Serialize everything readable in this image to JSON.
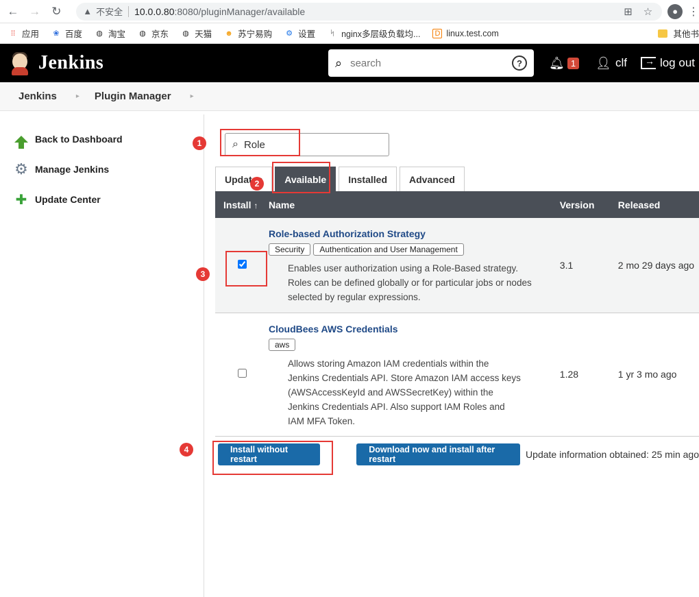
{
  "browser": {
    "warning": "不安全",
    "url_host": "10.0.0.80",
    "url_path": ":8080/pluginManager/available",
    "bookmarks": [
      "应用",
      "百度",
      "淘宝",
      "京东",
      "天猫",
      "苏宁易购",
      "设置",
      "nginx多层级负载均...",
      "linux.test.com"
    ],
    "other_bookmarks": "其他书"
  },
  "header": {
    "logo_text": "Jenkins",
    "search_placeholder": "search",
    "notifications_count": "1",
    "username": "clf",
    "logout": "log out"
  },
  "breadcrumb": {
    "items": [
      "Jenkins",
      "Plugin Manager"
    ]
  },
  "sidebar": {
    "items": [
      {
        "label": "Back to Dashboard"
      },
      {
        "label": "Manage Jenkins"
      },
      {
        "label": "Update Center"
      }
    ]
  },
  "filter": {
    "value": "Role"
  },
  "tabs": [
    {
      "label": "Updates"
    },
    {
      "label": "Available"
    },
    {
      "label": "Installed"
    },
    {
      "label": "Advanced"
    }
  ],
  "table": {
    "headers": {
      "install": "Install",
      "sort_marker": "↑",
      "name": "Name",
      "version": "Version",
      "released": "Released"
    },
    "rows": [
      {
        "name": "Role-based Authorization Strategy",
        "labels": [
          "Security",
          "Authentication and User Management"
        ],
        "description": "Enables user authorization using a Role-Based strategy. Roles can be defined globally or for particular jobs or nodes selected by regular expressions.",
        "version": "3.1",
        "released": "2 mo 29 days ago",
        "checked": true
      },
      {
        "name": "CloudBees AWS Credentials",
        "labels": [
          "aws"
        ],
        "description": "Allows storing Amazon IAM credentials within the Jenkins Credentials API. Store Amazon IAM access keys (AWSAccessKeyId and AWSSecretKey) within the Jenkins Credentials API. Also support IAM Roles and IAM MFA Token.",
        "version": "1.28",
        "released": "1 yr 3 mo ago",
        "checked": false
      }
    ]
  },
  "actions": {
    "install_without_restart": "Install without restart",
    "download_install_after_restart": "Download now and install after restart",
    "update_info": "Update information obtained: 25 min ago"
  },
  "annotations": [
    "1",
    "2",
    "3",
    "4"
  ],
  "colors": {
    "header_bg": "#000000",
    "accent_blue": "#1a6aa8",
    "annotation_red": "#e53935",
    "tab_active": "#4a4f57"
  }
}
